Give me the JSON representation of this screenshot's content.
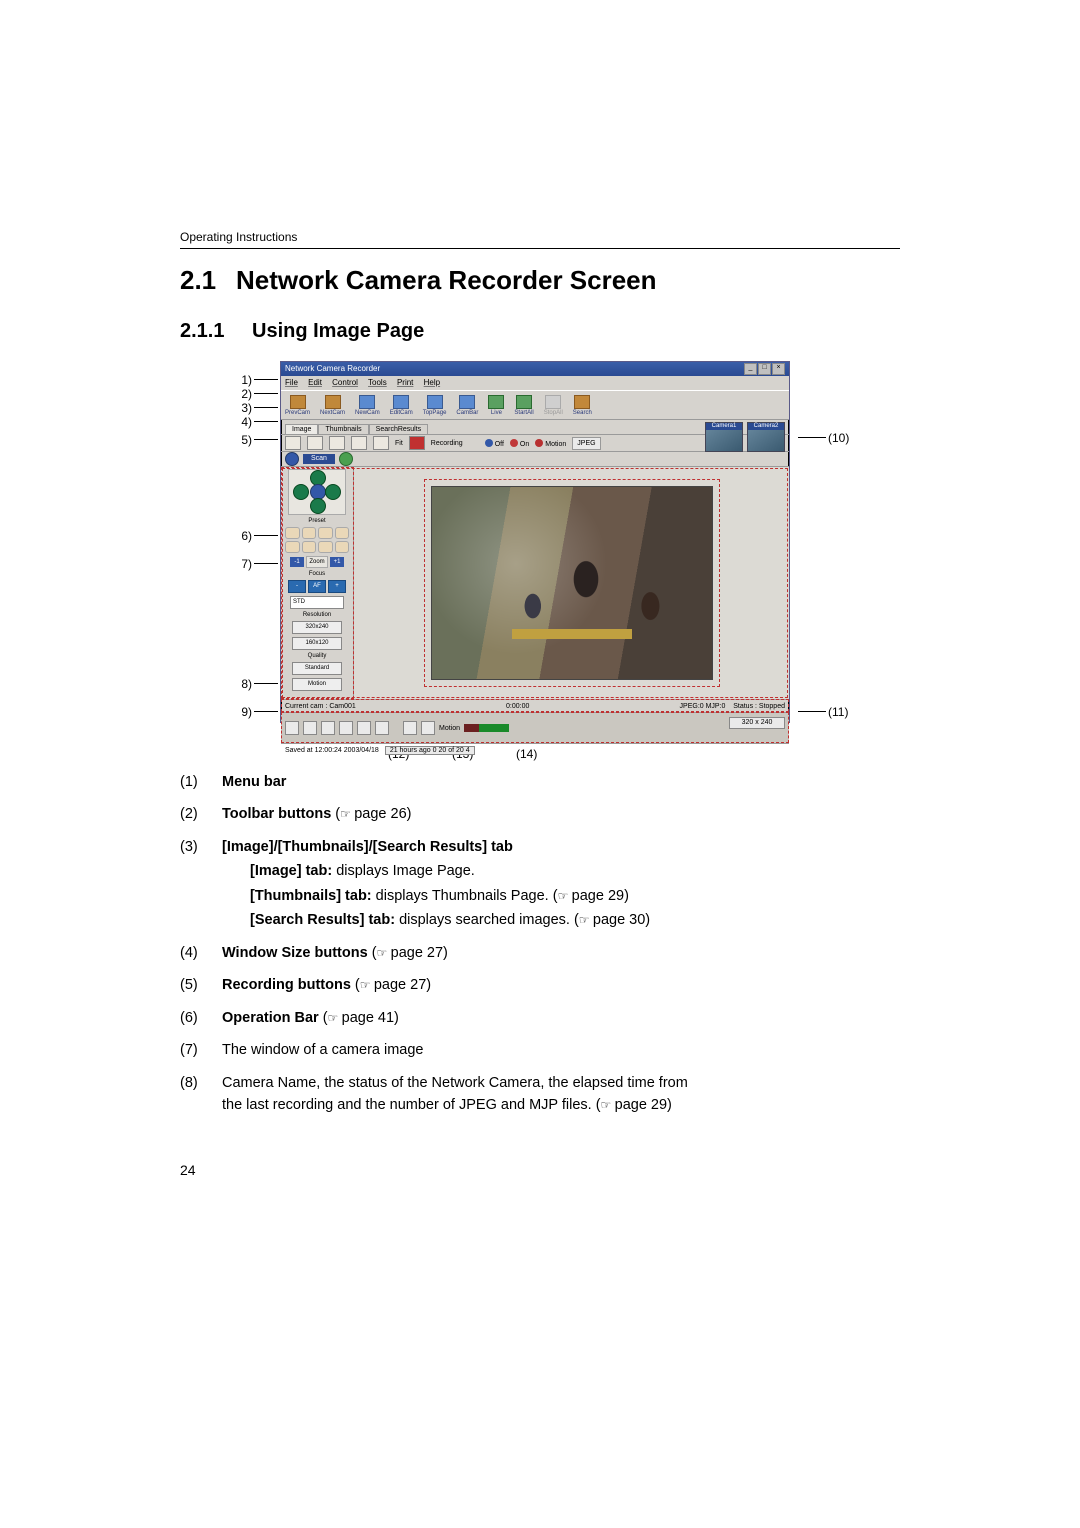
{
  "header_label": "Operating Instructions",
  "section": {
    "number": "2.1",
    "title": "Network Camera Recorder Screen"
  },
  "subsection": {
    "number": "2.1.1",
    "title": "Using Image Page"
  },
  "page_number": "24",
  "callouts": {
    "c1": "1)",
    "c2": "2)",
    "c3": "3)",
    "c4": "4)",
    "c5": "5)",
    "c6": "6)",
    "c7": "7)",
    "c8": "8)",
    "c9": "9)",
    "c10": "(10)",
    "c11": "(11)",
    "c12": "(12)",
    "c13": "(13)",
    "c14": "(14)"
  },
  "app": {
    "title": "Network Camera Recorder",
    "menu": {
      "file": "File",
      "edit": "Edit",
      "control": "Control",
      "tools": "Tools",
      "print": "Print",
      "help": "Help"
    },
    "toolbar": {
      "prev_cam": "PrevCam",
      "next_cam": "NextCam",
      "new_cam": "NewCam",
      "edit_cam": "EditCam",
      "top_page": "TopPage",
      "cam_bar": "CamBar",
      "live": "Live",
      "start_all": "StartAll",
      "stop_all": "StopAll",
      "search": "Search"
    },
    "tabs": {
      "image": "Image",
      "thumbnails": "Thumbnails",
      "search_results": "SearchResults"
    },
    "ctrl": {
      "recording": "Recording",
      "fit": "Fit",
      "off": "Off",
      "on": "On",
      "motion": "Motion",
      "mode": "JPEG"
    },
    "scan": "Scan",
    "thumbs": {
      "t1": "Camera1",
      "t2": "Camera2"
    },
    "sidebar": {
      "preset": "Preset",
      "zoom_minus": "-1",
      "zoom_label": "Zoom",
      "zoom_plus": "+1",
      "focus": "Focus",
      "af": "AF",
      "fm": "-",
      "fp": "+",
      "std_sel": "STD",
      "resolution_label": "Resolution",
      "res1": "320x240",
      "res2": "160x120",
      "quality_label": "Quality",
      "quality": "Standard",
      "motion": "Motion"
    },
    "status": {
      "current_cam_label": "Current cam :",
      "current_cam": "Cam001",
      "status_label": "Status :",
      "status": "Stopped",
      "elapsed": "0:00:00",
      "files": "JPEG:0  MJP:0"
    },
    "bottombar": {
      "motion_label": "Motion"
    },
    "saved": {
      "line": "Saved at 12:00:24 2003/04/18",
      "ago": "21 hours ago 0  20 of 20 4"
    },
    "dim": "320 x 240"
  },
  "definitions": {
    "d1": {
      "n": "(1)",
      "label": "Menu bar"
    },
    "d2": {
      "n": "(2)",
      "label": "Toolbar buttons",
      "page": " page 26)"
    },
    "d3": {
      "n": "(3)",
      "label": "[Image]/[Thumbnails]/[Search Results] tab",
      "sub_image_b": "[Image] tab:",
      "sub_image_t": " displays Image Page.",
      "sub_thumb_b": "[Thumbnails] tab:",
      "sub_thumb_t": " displays Thumbnails Page. (",
      "sub_thumb_p": " page 29)",
      "sub_search_b": "[Search Results] tab:",
      "sub_search_t": " displays searched images. (",
      "sub_search_p": " page 30)"
    },
    "d4": {
      "n": "(4)",
      "label": "Window Size buttons",
      "page": " page 27)"
    },
    "d5": {
      "n": "(5)",
      "label": "Recording buttons",
      "page": " page 27)"
    },
    "d6": {
      "n": "(6)",
      "label": "Operation Bar",
      "page": " page 41)"
    },
    "d7": {
      "n": "(7)",
      "text": "The window of a camera image"
    },
    "d8": {
      "n": "(8)",
      "text1": "Camera Name, the status of the Network Camera, the elapsed time from",
      "text2": "the last recording and the number of JPEG and MJP files. (",
      "page": " page 29)"
    }
  }
}
